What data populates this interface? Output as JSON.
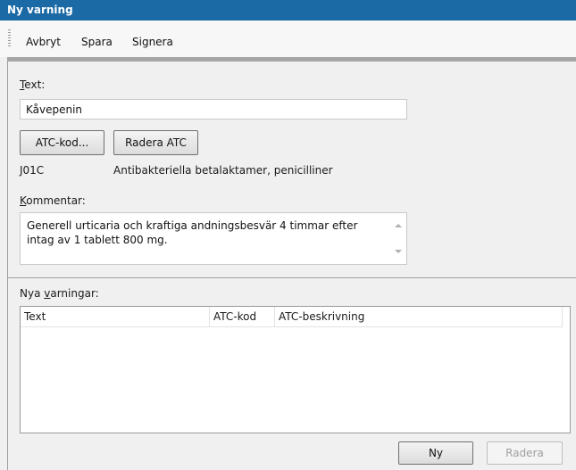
{
  "window": {
    "title": "Ny varning"
  },
  "menu": {
    "items": [
      "Avbryt",
      "Spara",
      "Signera"
    ]
  },
  "form": {
    "text_label": "Text:",
    "text_value": "Kåvepenin",
    "atc_button": "ATC-kod...",
    "clear_atc_button": "Radera ATC",
    "atc_code": "J01C",
    "atc_description": "Antibakteriella betalaktamer, penicilliner",
    "comment_label": "Kommentar:",
    "comment_value": "Generell urticaria och kraftiga andningsbesvär 4 timmar efter intag av 1 tablett 800 mg."
  },
  "warnings": {
    "label": "Nya varningar:",
    "columns": [
      "Text",
      "ATC-kod",
      "ATC-beskrivning"
    ],
    "rows": []
  },
  "buttons": {
    "new": "Ny",
    "delete": "Radera"
  }
}
